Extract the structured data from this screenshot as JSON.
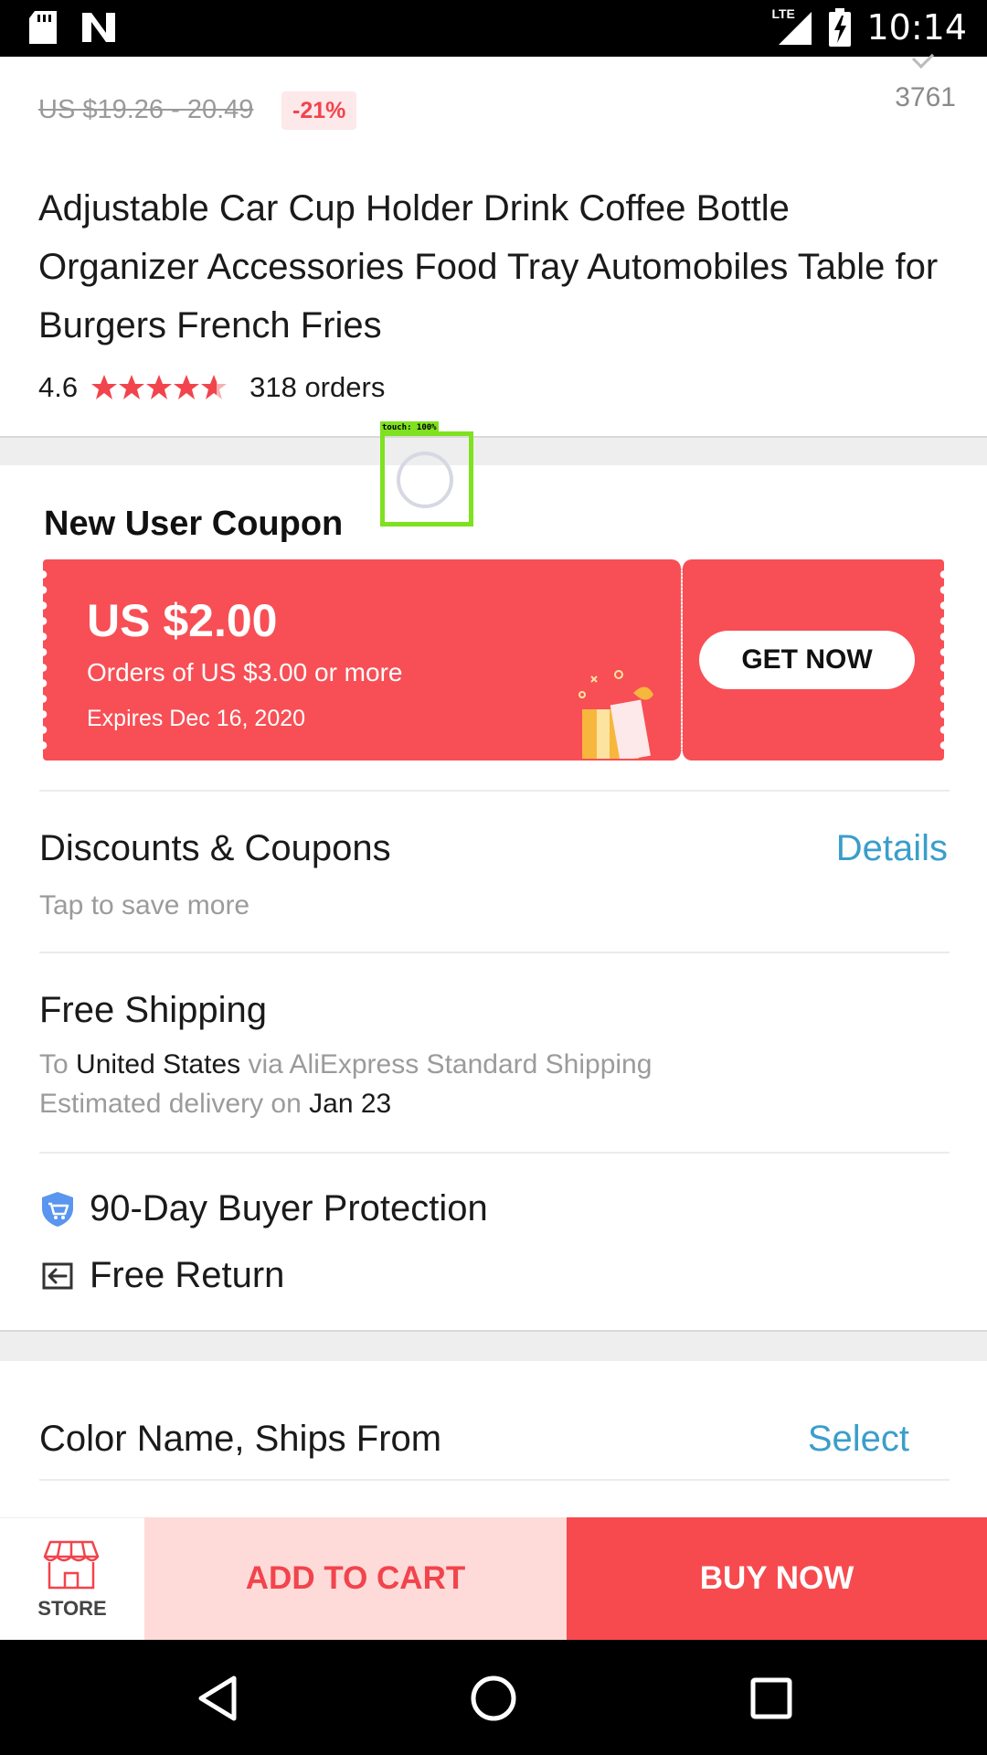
{
  "status_bar": {
    "time": "10:14",
    "network": "LTE"
  },
  "product": {
    "original_price": "US $19.26 - 20.49",
    "discount": "-21%",
    "wishlist_count": "3761",
    "title": "Adjustable Car Cup Holder Drink Coffee Bottle Organizer Accessories Food Tray Automobiles Table for Burgers French Fries",
    "rating": "4.6",
    "rating_stars": 4.6,
    "orders": "318 orders"
  },
  "coupon": {
    "section_title": "New User Coupon",
    "amount": "US $2.00",
    "condition": "Orders of US $3.00 or more",
    "expires": "Expires Dec 16, 2020",
    "button": "GET NOW",
    "color": "#f74f55"
  },
  "discounts": {
    "title": "Discounts & Coupons",
    "subtitle": "Tap to save more",
    "link": "Details"
  },
  "shipping": {
    "title": "Free Shipping",
    "to_prefix": "To",
    "country": "United States",
    "via": "via AliExpress Standard Shipping",
    "delivery_prefix": "Estimated delivery on",
    "delivery_date": "Jan 23"
  },
  "protection": {
    "buyer_protection": "90-Day Buyer Protection",
    "free_return": "Free Return"
  },
  "variant": {
    "title": "Color Name, Ships From",
    "link": "Select"
  },
  "touch_overlay": {
    "label": "touch: 100%"
  },
  "action_bar": {
    "store": "STORE",
    "add_to_cart": "ADD TO CART",
    "buy_now": "BUY NOW"
  },
  "colors": {
    "accent_red": "#f74a4f",
    "link_blue": "#3a9ecb",
    "cart_bg": "#fedbd9"
  }
}
